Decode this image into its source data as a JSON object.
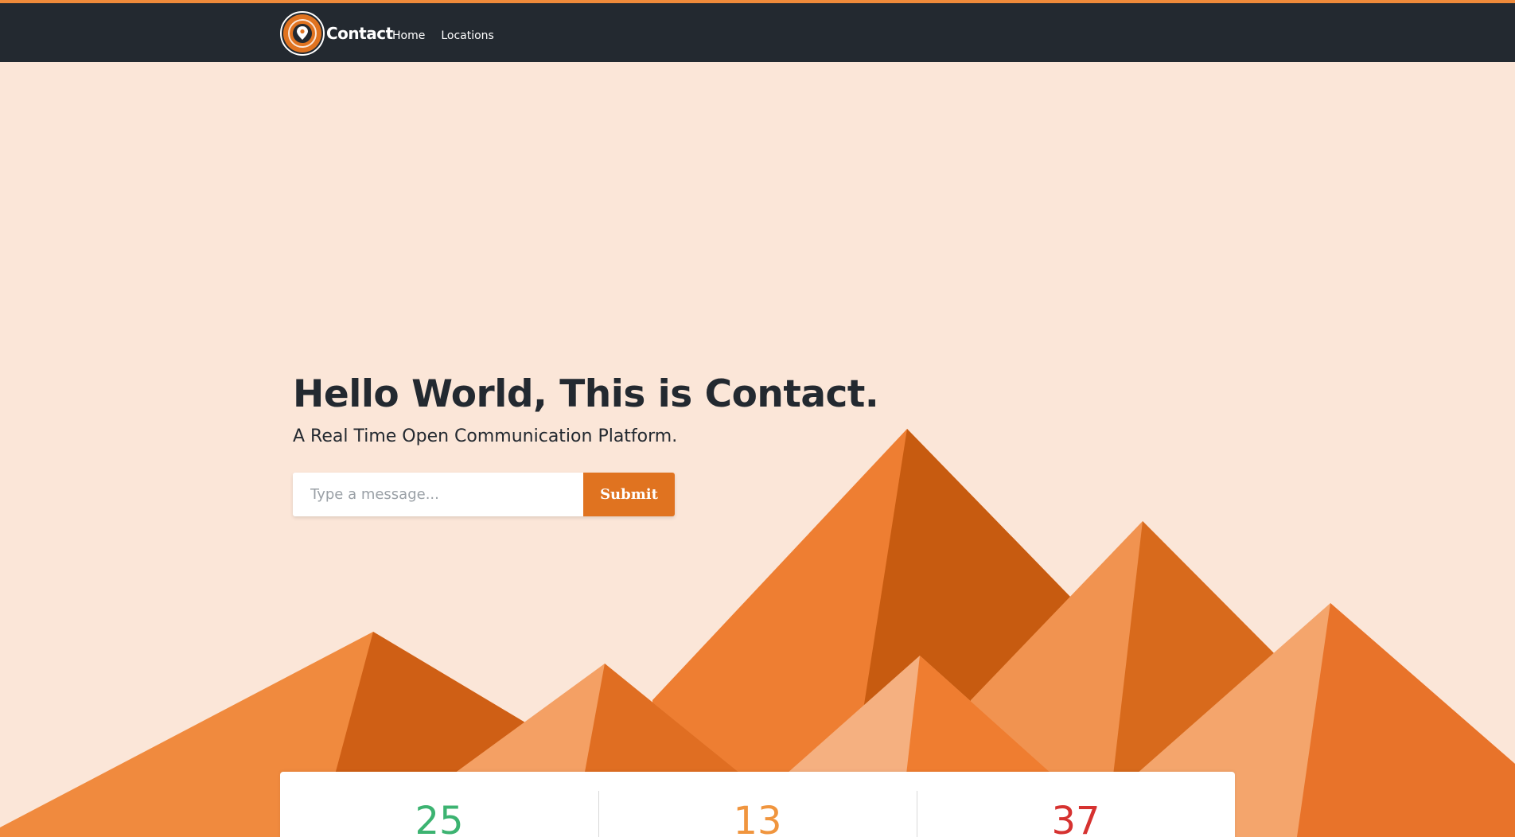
{
  "navbar": {
    "brand": "Contact",
    "logo_icon": "location-pin-icon",
    "links": [
      {
        "label": "Home"
      },
      {
        "label": "Locations"
      }
    ]
  },
  "hero": {
    "title": "Hello World, This is Contact.",
    "subtitle": "A Real Time Open Communication Platform.",
    "input_placeholder": "Type a message...",
    "input_value": "",
    "submit_label": "Submit"
  },
  "stats": [
    {
      "value": "25",
      "color": "#3cb371"
    },
    {
      "value": "13",
      "color": "#f0953e"
    },
    {
      "value": "37",
      "color": "#d63230"
    }
  ],
  "colors": {
    "accent": "#ee8a3a",
    "navbar_bg": "#232930",
    "page_bg": "#fbe6d8",
    "button": "#e07320"
  }
}
